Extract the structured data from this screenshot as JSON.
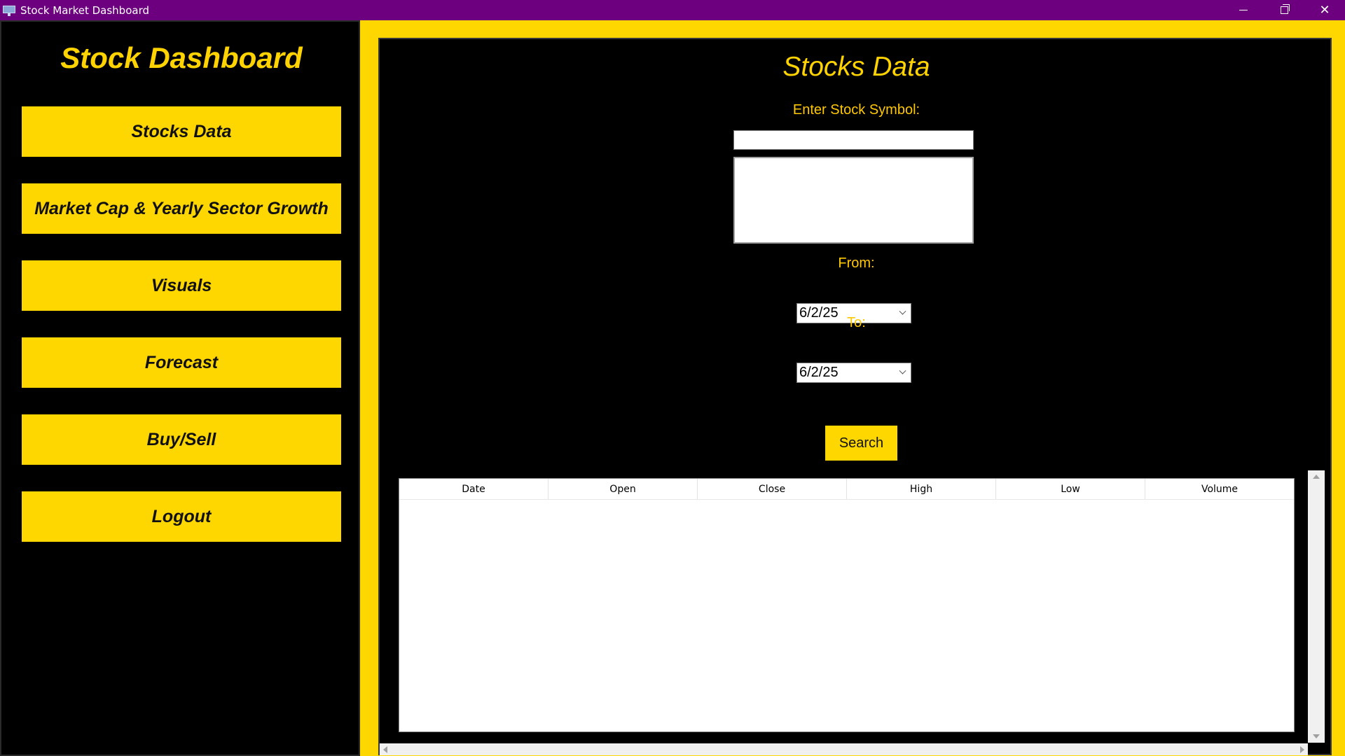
{
  "window": {
    "title": "Stock Market Dashboard"
  },
  "sidebar": {
    "title": "Stock Dashboard",
    "items": [
      {
        "label": "Stocks Data"
      },
      {
        "label": "Market Cap & Yearly Sector Growth"
      },
      {
        "label": "Visuals"
      },
      {
        "label": "Forecast"
      },
      {
        "label": "Buy/Sell"
      },
      {
        "label": "Logout"
      }
    ]
  },
  "main": {
    "title": "Stocks Data",
    "symbol_label": "Enter Stock Symbol:",
    "symbol_value": "",
    "from_label": "From:",
    "from_value": "6/2/25",
    "to_label": "To:",
    "to_value": "6/2/25",
    "search_label": "Search",
    "table": {
      "columns": [
        "Date",
        "Open",
        "Close",
        "High",
        "Low",
        "Volume"
      ],
      "rows": []
    }
  },
  "colors": {
    "titlebar": "#6c007e",
    "accent": "#ffd700",
    "background": "#000000"
  }
}
